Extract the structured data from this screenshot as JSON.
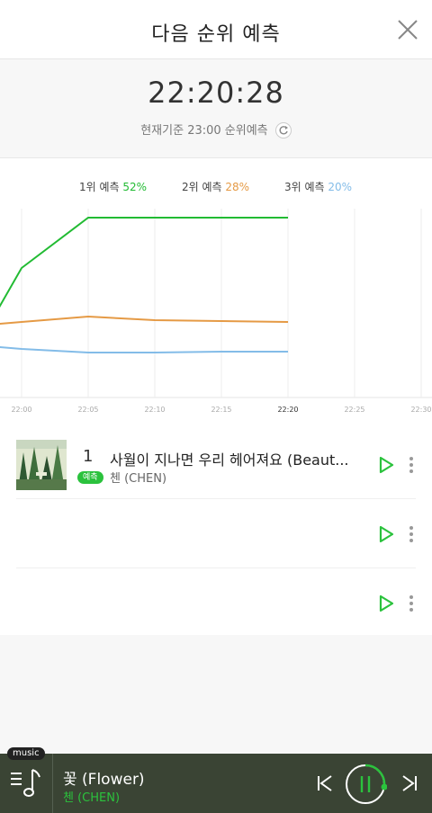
{
  "header": {
    "title": "다음 순위 예측",
    "close_icon": "close-icon"
  },
  "timebox": {
    "clock": "22:20:28",
    "basis": "현재기준 23:00 순위예측",
    "refresh_icon": "refresh-icon"
  },
  "legend": [
    {
      "label": "1위 예측",
      "percent": "52%",
      "color": "#22bb33"
    },
    {
      "label": "2위 예측",
      "percent": "28%",
      "color": "#e59a45"
    },
    {
      "label": "3위 예측",
      "percent": "20%",
      "color": "#83bce8"
    }
  ],
  "chart_data": {
    "type": "line",
    "x": [
      "22:00",
      "22:05",
      "22:10",
      "22:15",
      "22:20",
      "22:25",
      "22:30"
    ],
    "series": [
      {
        "name": "1위 예측",
        "color": "#22bb33",
        "values": [
          72,
          100,
          100,
          100,
          100,
          null,
          null
        ]
      },
      {
        "name": "2위 예측",
        "color": "#e59a45",
        "values": [
          42,
          45,
          43,
          42.5,
          42,
          null,
          null
        ]
      },
      {
        "name": "3위 예측",
        "color": "#83bce8",
        "values": [
          27,
          25,
          25,
          25.5,
          25.5,
          null,
          null
        ]
      }
    ],
    "highlight_x": "22:20",
    "grid": true
  },
  "list": [
    {
      "rank": "1",
      "badge": "예측",
      "title": "사월이 지나면 우리 헤어져요 (Beaut...",
      "artist": "첸 (CHEN)"
    },
    {
      "rank": "",
      "badge": "",
      "title": "",
      "artist": ""
    },
    {
      "rank": "",
      "badge": "",
      "title": "",
      "artist": ""
    }
  ],
  "player": {
    "tag": "music",
    "title": "꽃 (Flower)",
    "artist": "첸 (CHEN)",
    "accent": "#2bc23d",
    "background": "#3a4434"
  }
}
